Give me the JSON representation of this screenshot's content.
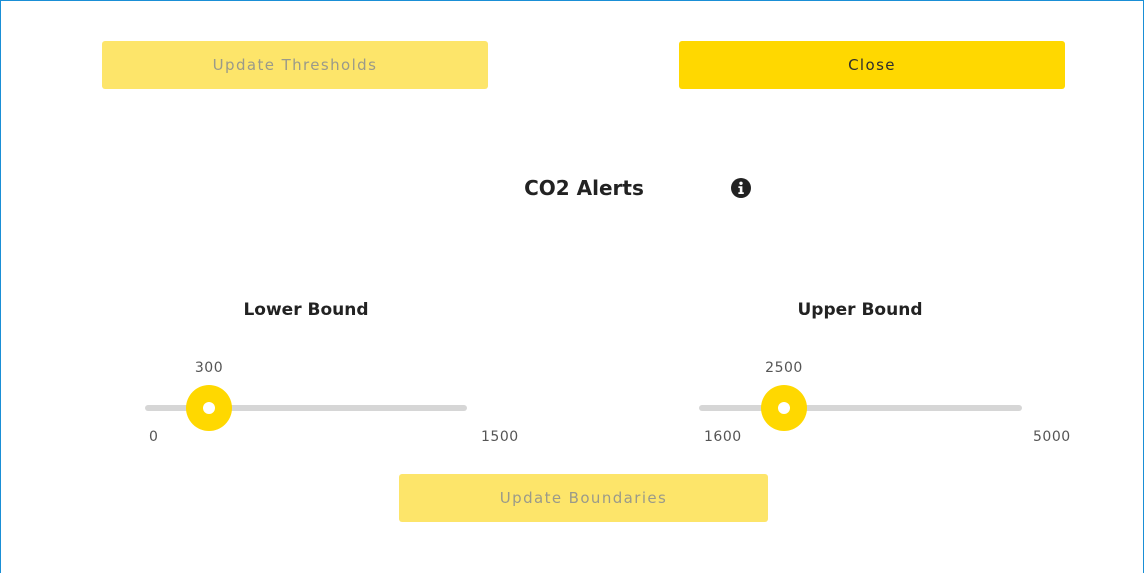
{
  "buttons": {
    "update_thresholds": "Update Thresholds",
    "close": "Close",
    "update_boundaries": "Update Boundaries"
  },
  "title": "CO2 Alerts",
  "info_icon": "info-circle-icon",
  "lower": {
    "label": "Lower Bound",
    "value": "300",
    "min": "0",
    "max": "1500",
    "fraction": 0.2
  },
  "upper": {
    "label": "Upper Bound",
    "value": "2500",
    "min": "1600",
    "max": "5000",
    "fraction": 0.2647
  },
  "colors": {
    "accent": "#ffd800",
    "accent_disabled": "#fde56a",
    "track": "#d6d6d6",
    "frame_border": "#1a8fd6"
  }
}
